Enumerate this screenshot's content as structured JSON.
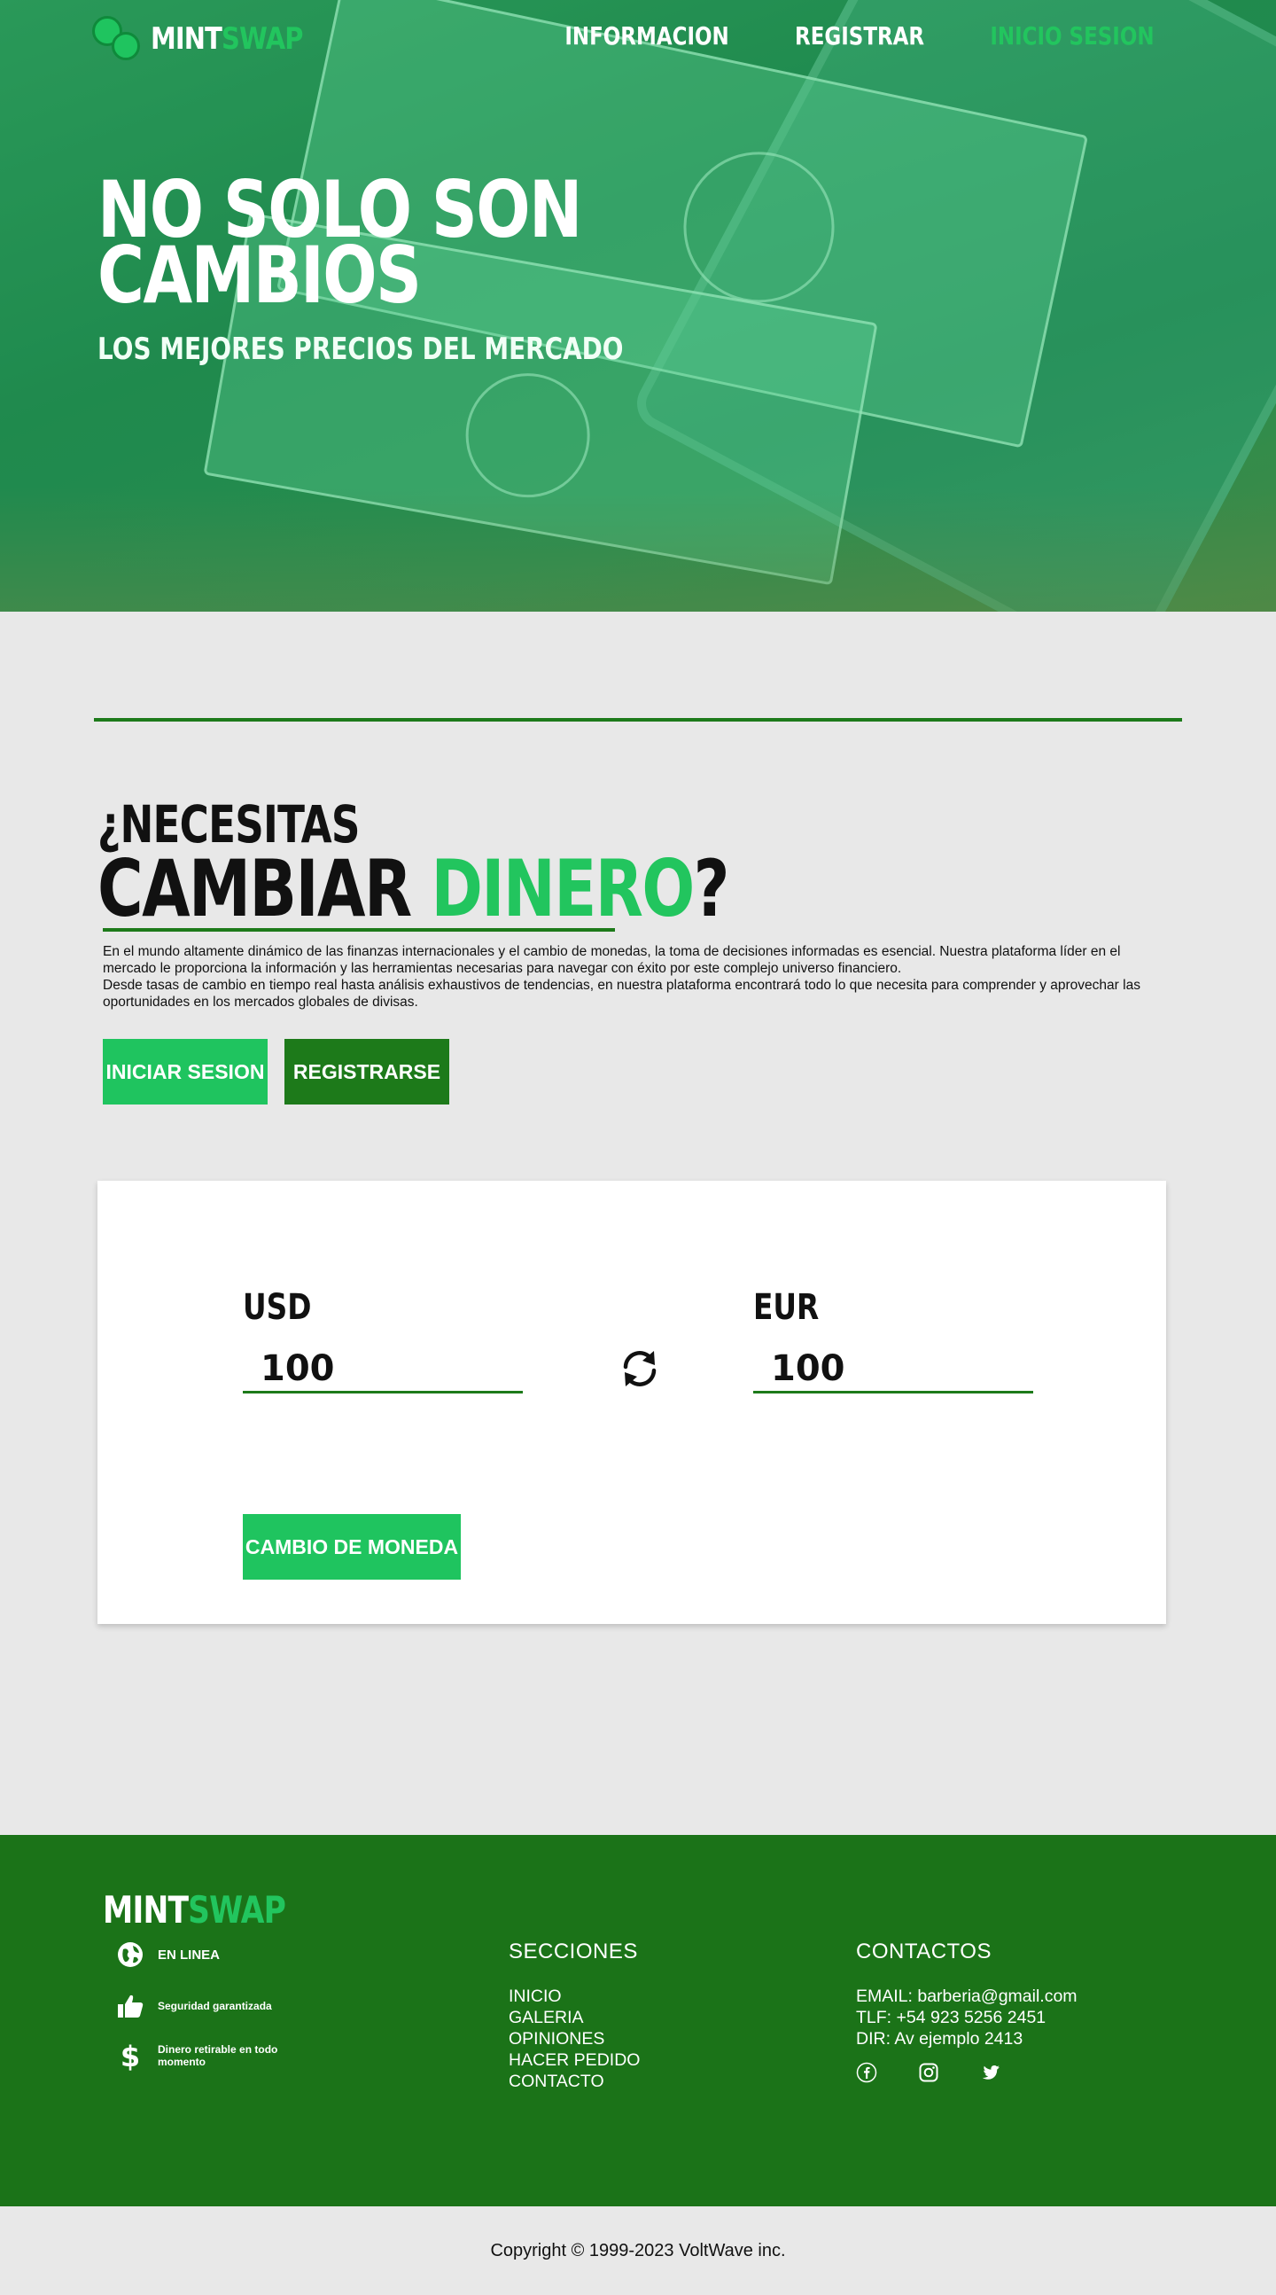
{
  "brand": {
    "part1": "MINT",
    "part2": "SWAP"
  },
  "nav": {
    "items": [
      "INFORMACION",
      "REGISTRAR",
      "INICIO SESION"
    ]
  },
  "hero": {
    "title_line1": "NO SOLO SON",
    "title_line2": "CAMBIOS",
    "subtitle": "LOS MEJORES PRECIOS DEL MERCADO"
  },
  "intro": {
    "heading_small": "¿NECESITAS",
    "heading_big_a": "CAMBIAR ",
    "heading_big_b": "DINERO",
    "heading_big_c": "?",
    "paragraph1": "En el mundo altamente dinámico de las finanzas internacionales y el cambio de monedas, la toma de decisiones informadas es esencial. Nuestra plataforma líder en el mercado le proporciona la información y las herramientas necesarias para navegar con éxito por este complejo universo financiero.",
    "paragraph2": "Desde tasas de cambio en tiempo real hasta análisis exhaustivos de tendencias, en nuestra plataforma encontrará todo lo que necesita para comprender y aprovechar las oportunidades en los mercados globales de divisas.",
    "login_label": "INICIAR SESION",
    "register_label": "REGISTRARSE"
  },
  "converter": {
    "from_currency": "USD",
    "from_value": "100",
    "to_currency": "EUR",
    "to_value": "100",
    "button_label": "CAMBIO DE MONEDA"
  },
  "footer": {
    "features": [
      "EN LINEA",
      "Seguridad garantizada",
      "Dinero retirable en todo momento"
    ],
    "sections_title": "SECCIONES",
    "sections": [
      "INICIO",
      "GALERIA",
      "OPINIONES",
      "HACER PEDIDO",
      "CONTACTO"
    ],
    "contacts_title": "CONTACTOS",
    "email": "EMAIL: barberia@gmail.com",
    "phone": "TLF: +54 923 5256 2451",
    "address": "DIR: Av ejemplo 2413",
    "socials": [
      "facebook-icon",
      "instagram-icon",
      "twitter-icon"
    ]
  },
  "copyright": "Copyright © 1999-2023 VoltWave inc.",
  "colors": {
    "accent": "#22c55e",
    "button_green": "#1fc45f",
    "dark_green": "#1d7a1a",
    "footer_bg": "#1b7318",
    "page_bg": "#e8e8e8"
  }
}
